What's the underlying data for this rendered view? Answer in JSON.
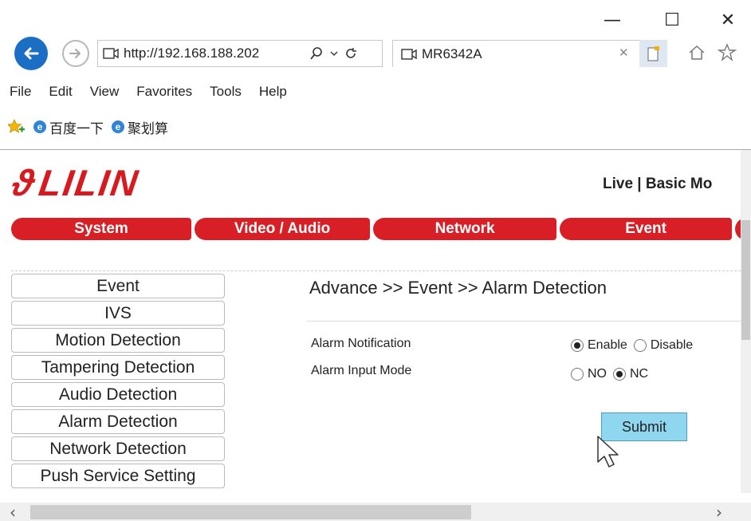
{
  "window": {
    "minimize_glyph": "—",
    "maximize_glyph": "☐",
    "close_glyph": "✕"
  },
  "browser": {
    "address": "http://192.168.188.202",
    "tab_title": "MR6342A",
    "menu": [
      "File",
      "Edit",
      "View",
      "Favorites",
      "Tools",
      "Help"
    ],
    "favorites": [
      "百度一下",
      "聚划算"
    ]
  },
  "page": {
    "logo": "LILIN",
    "top_links": "Live  |  Basic Mo",
    "tabs": [
      "System",
      "Video / Audio",
      "Network",
      "Event",
      ""
    ],
    "sidebar": [
      "Event",
      "IVS",
      "Motion Detection",
      "Tampering Detection",
      "Audio Detection",
      "Alarm Detection",
      "Network Detection",
      "Push Service Setting"
    ],
    "breadcrumb": "Advance >> Event >> Alarm Detection",
    "alarm_notification": {
      "label": "Alarm Notification",
      "options": [
        "Enable",
        "Disable"
      ],
      "selected": "Enable"
    },
    "alarm_input_mode": {
      "label": "Alarm Input Mode",
      "options": [
        "NO",
        "NC"
      ],
      "selected": "NC"
    },
    "submit_label": "Submit"
  },
  "colors": {
    "brand_red": "#d91f26",
    "submit_bg": "#8fd6ef",
    "back_button": "#1a6fc4"
  }
}
